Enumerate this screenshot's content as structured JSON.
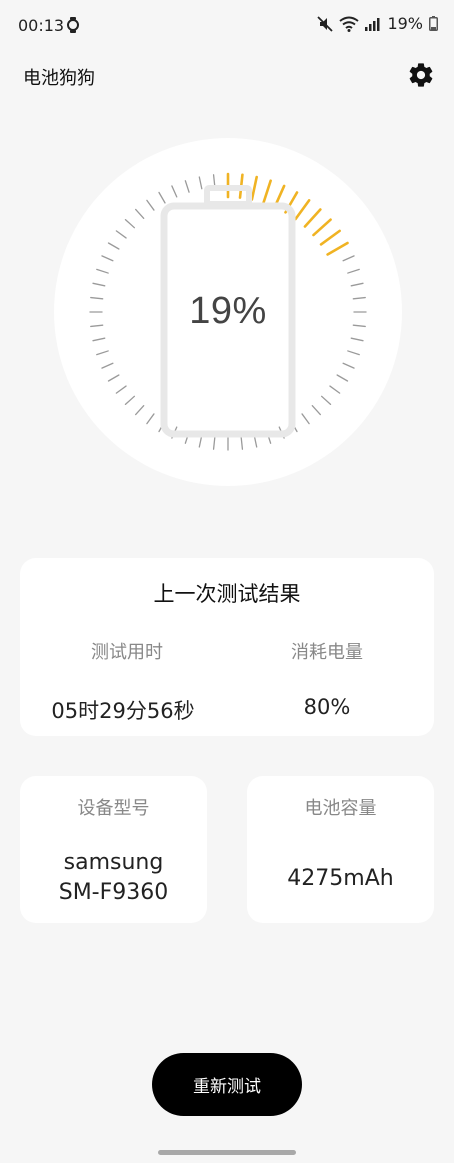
{
  "status_bar": {
    "time": "00:13",
    "battery_text": "19%",
    "icons": [
      "watch-icon",
      "mute-icon",
      "wifi-icon",
      "signal-icon",
      "battery-icon"
    ]
  },
  "header": {
    "title": "电池狗狗",
    "settings_icon": "gear-icon"
  },
  "battery": {
    "percent_text": "19%",
    "level": 0.19,
    "accent_color": "#f0b323",
    "inactive_tick_color": "#9a9a9a"
  },
  "last_test": {
    "title": "上一次测试结果",
    "duration_label": "测试用时",
    "duration_value": "05时29分56秒",
    "consumed_label": "消耗电量",
    "consumed_value": "80%"
  },
  "device": {
    "label": "设备型号",
    "line1": "samsung",
    "line2": "SM-F9360"
  },
  "capacity": {
    "label": "电池容量",
    "value": "4275mAh"
  },
  "actions": {
    "retest_label": "重新测试"
  }
}
